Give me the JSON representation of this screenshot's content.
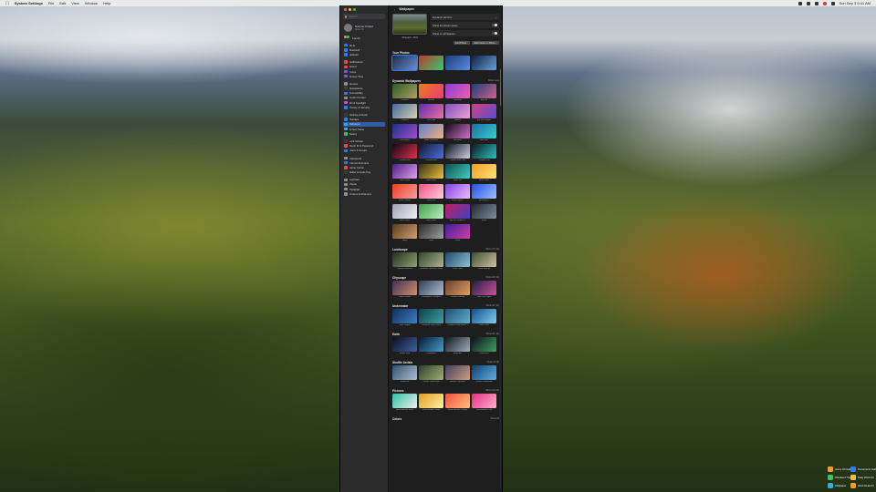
{
  "menubar": {
    "app_name": "System Settings",
    "menus": [
      "File",
      "Edit",
      "View",
      "Window",
      "Help"
    ],
    "clock": "Sun Sep 3 9:41 AM",
    "status_icons": [
      "control-center-icon",
      "wifi-icon",
      "battery-icon",
      "siri-icon",
      "spotlight-icon"
    ]
  },
  "window": {
    "sidebar": {
      "search_placeholder": "Search",
      "account_name": "Sumner Kristof",
      "account_sub": "Apple ID",
      "family_label": "Family",
      "groups": [
        [
          {
            "label": "Wi-Fi",
            "color": "#2f7cf6"
          },
          {
            "label": "Bluetooth",
            "color": "#2f7cf6"
          },
          {
            "label": "Network",
            "color": "#2f7cf6"
          }
        ],
        [
          {
            "label": "Notifications",
            "color": "#ef4444"
          },
          {
            "label": "Sound",
            "color": "#ef4444"
          },
          {
            "label": "Focus",
            "color": "#6d5ae6"
          },
          {
            "label": "Screen Time",
            "color": "#6d5ae6"
          }
        ],
        [
          {
            "label": "General",
            "color": "#8e8e93"
          },
          {
            "label": "Appearance",
            "color": "#3a3a3c"
          },
          {
            "label": "Accessibility",
            "color": "#2f7cf6"
          },
          {
            "label": "Control Center",
            "color": "#8e8e93"
          },
          {
            "label": "Siri & Spotlight",
            "color": "#c84fe0"
          },
          {
            "label": "Privacy & Security",
            "color": "#2f7cf6"
          }
        ],
        [
          {
            "label": "Desktop & Dock",
            "color": "#3a3a3c"
          },
          {
            "label": "Displays",
            "color": "#2f7cf6"
          },
          {
            "label": "Wallpaper",
            "color": "#32ade6",
            "active": true
          },
          {
            "label": "Screen Saver",
            "color": "#32ade6"
          },
          {
            "label": "Battery",
            "color": "#34c759"
          }
        ],
        [
          {
            "label": "Lock Screen",
            "color": "#3a3a3c"
          },
          {
            "label": "Touch ID & Password",
            "color": "#ef4444"
          },
          {
            "label": "Users & Groups",
            "color": "#2f7cf6"
          }
        ],
        [
          {
            "label": "Passwords",
            "color": "#8e8e93"
          },
          {
            "label": "Internet Accounts",
            "color": "#2f7cf6"
          },
          {
            "label": "Game Center",
            "color": "#ef4444"
          },
          {
            "label": "Wallet & Apple Pay",
            "color": "#3a3a3c"
          }
        ],
        [
          {
            "label": "Keyboard",
            "color": "#8e8e93"
          },
          {
            "label": "Mouse",
            "color": "#8e8e93"
          },
          {
            "label": "Trackpad",
            "color": "#8e8e93"
          },
          {
            "label": "Printers & Scanners",
            "color": "#8e8e93"
          }
        ]
      ]
    },
    "main": {
      "title": "Wallpaper",
      "current_caption": "Vineyard - 16:9",
      "controls": [
        {
          "label": "Dynamic Horizon",
          "toggle": false
        },
        {
          "label": "Show as screen saver",
          "toggle": true
        },
        {
          "label": "Show on all Spaces",
          "toggle": true
        }
      ],
      "buttons": [
        "Add Photo...",
        "Add Folder or Album..."
      ],
      "sections": [
        {
          "title": "Your Photos",
          "more": "",
          "tiles": [
            {
              "caption": "",
              "colors": [
                "#1d2a4a",
                "#6b8fd6"
              ]
            },
            {
              "caption": "",
              "colors": [
                "#c0392b",
                "#2ecc71"
              ]
            },
            {
              "caption": "",
              "colors": [
                "#1a3d7c",
                "#5a8ce0"
              ]
            },
            {
              "caption": "",
              "colors": [
                "#0f2144",
                "#6aa0d8"
              ]
            }
          ]
        },
        {
          "title": "Dynamic Wallpapers",
          "more": "Show Less",
          "tiles": [
            {
              "caption": "Sonoma",
              "colors": [
                "#2c5a2a",
                "#b0a060"
              ]
            },
            {
              "caption": "Ventura",
              "colors": [
                "#f07a1a",
                "#e93a7c"
              ]
            },
            {
              "caption": "Monterey",
              "colors": [
                "#8a3bd8",
                "#ef5fa7"
              ]
            },
            {
              "caption": "Big Sur",
              "colors": [
                "#1f3f7a",
                "#d06090"
              ]
            },
            {
              "caption": "Catalina",
              "colors": [
                "#3f6aa0",
                "#d8d0b0"
              ]
            },
            {
              "caption": "The Cliffs",
              "colors": [
                "#5a2fb0",
                "#f06fa0"
              ]
            },
            {
              "caption": "Mojave",
              "colors": [
                "#8050c0",
                "#f0a0d0"
              ]
            },
            {
              "caption": "Big Sur Graphic",
              "colors": [
                "#d04080",
                "#5a4fd0"
              ]
            },
            {
              "caption": "The Beach",
              "colors": [
                "#1f2f8a",
                "#9f4fd0"
              ]
            },
            {
              "caption": "Solar Gradients",
              "colors": [
                "#6080d0",
                "#f0b080"
              ]
            },
            {
              "caption": "Macintosh",
              "colors": [
                "#101010",
                "#d070d0"
              ]
            },
            {
              "caption": "Hello Blue",
              "colors": [
                "#1f6fa0",
                "#30d0d0"
              ]
            },
            {
              "caption": "Chroma Red",
              "colors": [
                "#100818",
                "#e0304a"
              ]
            },
            {
              "caption": "Chroma Blue",
              "colors": [
                "#101830",
                "#4a70e0"
              ]
            },
            {
              "caption": "Chroma Blue Dark",
              "colors": [
                "#0a1020",
                "#d0d0e0"
              ]
            },
            {
              "caption": "Chroma Teal",
              "colors": [
                "#0a1a20",
                "#30c0c0"
              ]
            },
            {
              "caption": "Hello Purple",
              "colors": [
                "#502080",
                "#e0a0f0"
              ]
            },
            {
              "caption": "Hello Gold",
              "colors": [
                "#303010",
                "#f0c040"
              ]
            },
            {
              "caption": "Hello Teal",
              "colors": [
                "#0f4f4f",
                "#40d0c0"
              ]
            },
            {
              "caption": "Hello Yellow",
              "colors": [
                "#f0a020",
                "#ffe080"
              ]
            },
            {
              "caption": "Hello Orange",
              "colors": [
                "#f04020",
                "#f0a0a0"
              ]
            },
            {
              "caption": "Hello Pink",
              "colors": [
                "#f05080",
                "#ffd0e0"
              ]
            },
            {
              "caption": "Hello Purple 2",
              "colors": [
                "#8040e0",
                "#f0c0ff"
              ]
            },
            {
              "caption": "Hello Blue 2",
              "colors": [
                "#2050e0",
                "#a0c0ff"
              ]
            },
            {
              "caption": "Hello Silver",
              "colors": [
                "#a0a0b0",
                "#f0f0f8"
              ]
            },
            {
              "caption": "Hello Green",
              "colors": [
                "#3f9f4f",
                "#c0f0c0"
              ]
            },
            {
              "caption": "Big Sur Graphic 2",
              "colors": [
                "#c02060",
                "#4040c0"
              ]
            },
            {
              "caption": "Haze",
              "colors": [
                "#202830",
                "#8090a0"
              ]
            },
            {
              "caption": "Valley",
              "colors": [
                "#5a3a20",
                "#d0a070"
              ]
            },
            {
              "caption": "Dome",
              "colors": [
                "#2a2a2a",
                "#a0a0a0"
              ]
            },
            {
              "caption": "Peak",
              "colors": [
                "#40209f",
                "#d040a0"
              ]
            },
            {
              "caption": "",
              "colors": [
                "#1e1e1e",
                "#1e1e1e"
              ]
            }
          ]
        },
        {
          "title": "Landscape",
          "more": "Show All (12)",
          "tiles": [
            {
              "caption": "Sonoma Horizon",
              "colors": [
                "#1f3020",
                "#8fa070"
              ]
            },
            {
              "caption": "California Yosemite Valley",
              "colors": [
                "#2f4a2f",
                "#b0b090"
              ]
            },
            {
              "caption": "Great Lakes",
              "colors": [
                "#1f4a6a",
                "#90c0d0"
              ]
            },
            {
              "caption": "Coral Springs",
              "colors": [
                "#3f4f2f",
                "#d0c0a0"
              ]
            }
          ]
        },
        {
          "title": "Cityscape",
          "more": "Show All (10)",
          "tiles": [
            {
              "caption": "Dubai Skyline",
              "colors": [
                "#3f2f4f",
                "#d09070"
              ]
            },
            {
              "caption": "Los Angeles Overpass",
              "colors": [
                "#2f3f5f",
                "#b0c0d0"
              ]
            },
            {
              "caption": "London Evening",
              "colors": [
                "#6a3f2f",
                "#e0a060"
              ]
            },
            {
              "caption": "New York Night",
              "colors": [
                "#1f1f3f",
                "#d050a0"
              ]
            }
          ]
        },
        {
          "title": "Underwater",
          "more": "Show All (11)",
          "tiles": [
            {
              "caption": "Palau Jellyfish",
              "colors": [
                "#0f2f5f",
                "#3f80c0"
              ]
            },
            {
              "caption": "California Kelp Forest",
              "colors": [
                "#0f3f4f",
                "#40a0a0"
              ]
            },
            {
              "caption": "California Kelp Forest 2",
              "colors": [
                "#1f4f6f",
                "#60b0d0"
              ]
            },
            {
              "caption": "Palau Coral",
              "colors": [
                "#0f4f8f",
                "#80d0f0"
              ]
            }
          ]
        },
        {
          "title": "Earth",
          "more": "Show All (11)",
          "tiles": [
            {
              "caption": "Middle East",
              "colors": [
                "#0a1020",
                "#4060a0"
              ]
            },
            {
              "caption": "Caribbean",
              "colors": [
                "#0a1830",
                "#3fa0d0"
              ]
            },
            {
              "caption": "Antarctica",
              "colors": [
                "#101820",
                "#a0b0c0"
              ]
            },
            {
              "caption": "Greenland",
              "colors": [
                "#0a1020",
                "#40a060"
              ]
            }
          ]
        },
        {
          "title": "Shuffle Aerials",
          "more": "Show All (5)",
          "tiles": [
            {
              "caption": "Shuffle All",
              "colors": [
                "#2f4f6f",
                "#b0c0d0"
              ]
            },
            {
              "caption": "Shuffle Landscape",
              "colors": [
                "#2f3f2f",
                "#a0b070"
              ]
            },
            {
              "caption": "Shuffle Cityscape",
              "colors": [
                "#3f3f5f",
                "#d0a080"
              ]
            },
            {
              "caption": "Shuffle Underwater",
              "colors": [
                "#0f3f6f",
                "#60b0e0"
              ]
            }
          ]
        },
        {
          "title": "Pictures",
          "more": "Show All (22)",
          "tiles": [
            {
              "caption": "Hello Metallic Silver",
              "colors": [
                "#30c0a0",
                "#f0f0f0"
              ]
            },
            {
              "caption": "Hello Metallic Yellow",
              "colors": [
                "#e0a020",
                "#fff0a0"
              ]
            },
            {
              "caption": "Hello Metallic Orange",
              "colors": [
                "#f05040",
                "#ffc080"
              ]
            },
            {
              "caption": "Hello Metallic Pink",
              "colors": [
                "#e03080",
                "#ffb0d0"
              ]
            }
          ]
        },
        {
          "title": "Colors",
          "more": "Show All",
          "tiles": []
        }
      ]
    }
  },
  "widgets": [
    {
      "label": "Home Kit Gallery",
      "color": "#f0a020"
    },
    {
      "label": "Documents Gallery",
      "color": "#2f7cf6"
    },
    {
      "label": "Weekend Trip",
      "color": "#34c759"
    },
    {
      "label": "Daily Work Kit",
      "color": "#f0c040"
    },
    {
      "label": "Wallpaper",
      "color": "#32ade6"
    },
    {
      "label": "Work Desk Kit",
      "color": "#f0a020"
    }
  ]
}
